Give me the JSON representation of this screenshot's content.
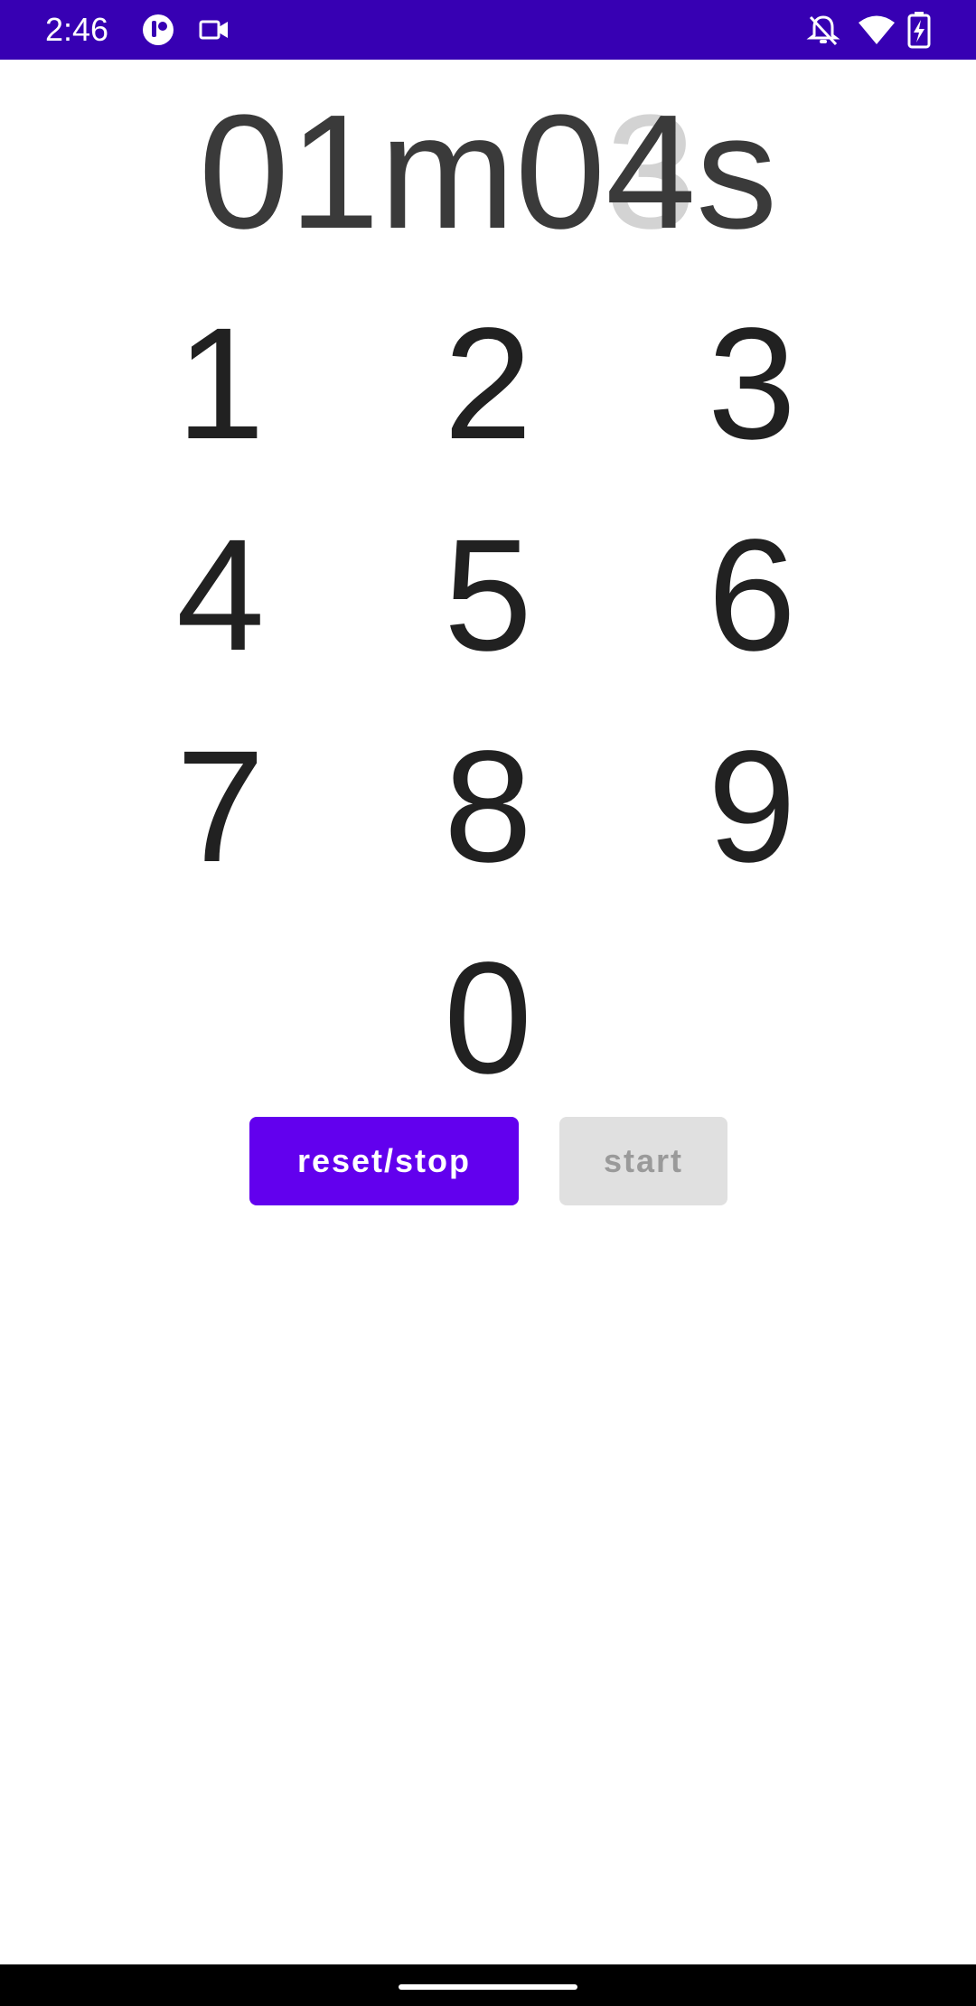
{
  "status_bar": {
    "time": "2:46",
    "icons": [
      "app-notification-icon",
      "video-camera-icon",
      "notifications-off-icon",
      "wifi-icon",
      "battery-charging-icon"
    ]
  },
  "timer": {
    "minutes": "01",
    "minutes_unit": "m",
    "seconds_tens": "0",
    "seconds_ones_previous": "3",
    "seconds_ones": "4",
    "seconds_unit": "s"
  },
  "keypad": {
    "keys": [
      "1",
      "2",
      "3",
      "4",
      "5",
      "6",
      "7",
      "8",
      "9",
      "0"
    ]
  },
  "buttons": {
    "reset_label": "reset/stop",
    "start_label": "start",
    "start_enabled": false
  },
  "colors": {
    "status_bar": "#3700B3",
    "accent": "#6200EE",
    "timer_text": "#3a3a3a",
    "timer_ghost": "#d3d3d3",
    "disabled_button": "#e0e0e0"
  }
}
